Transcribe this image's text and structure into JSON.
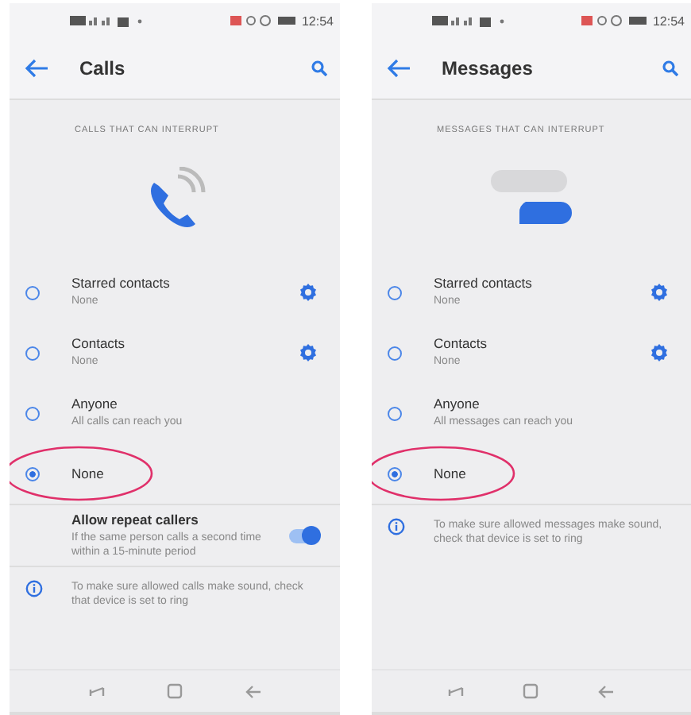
{
  "screens": [
    {
      "time": "12:54",
      "title": "Calls",
      "section_header": "CALLS THAT CAN INTERRUPT",
      "illustration": {
        "kind": "call"
      },
      "options": [
        {
          "label": "Starred contacts",
          "sublabel": "None",
          "selected": false,
          "has_settings": true,
          "circled": false
        },
        {
          "label": "Contacts",
          "sublabel": "None",
          "selected": false,
          "has_settings": true,
          "circled": false
        },
        {
          "label": "Anyone",
          "sublabel": "All calls can reach you",
          "selected": false,
          "has_settings": false,
          "circled": false
        },
        {
          "label": "None",
          "selected": true,
          "has_settings": false,
          "circled": true
        }
      ],
      "repeat_callers": {
        "label": "Allow repeat callers",
        "description": "If the same person calls a second time within a 15-minute period",
        "on": true
      },
      "info": "To make sure allowed calls make sound, check that device is set to ring"
    },
    {
      "time": "12:54",
      "title": "Messages",
      "section_header": "MESSAGES THAT CAN INTERRUPT",
      "illustration": {
        "kind": "message"
      },
      "options": [
        {
          "label": "Starred contacts",
          "sublabel": "None",
          "selected": false,
          "has_settings": true,
          "circled": false
        },
        {
          "label": "Contacts",
          "sublabel": "None",
          "selected": false,
          "has_settings": true,
          "circled": false
        },
        {
          "label": "Anyone",
          "sublabel": "All messages can reach you",
          "selected": false,
          "has_settings": false,
          "circled": false
        },
        {
          "label": "None",
          "selected": true,
          "has_settings": false,
          "circled": true
        }
      ],
      "info": "To make sure allowed messages make sound, check that device is set to ring"
    }
  ]
}
